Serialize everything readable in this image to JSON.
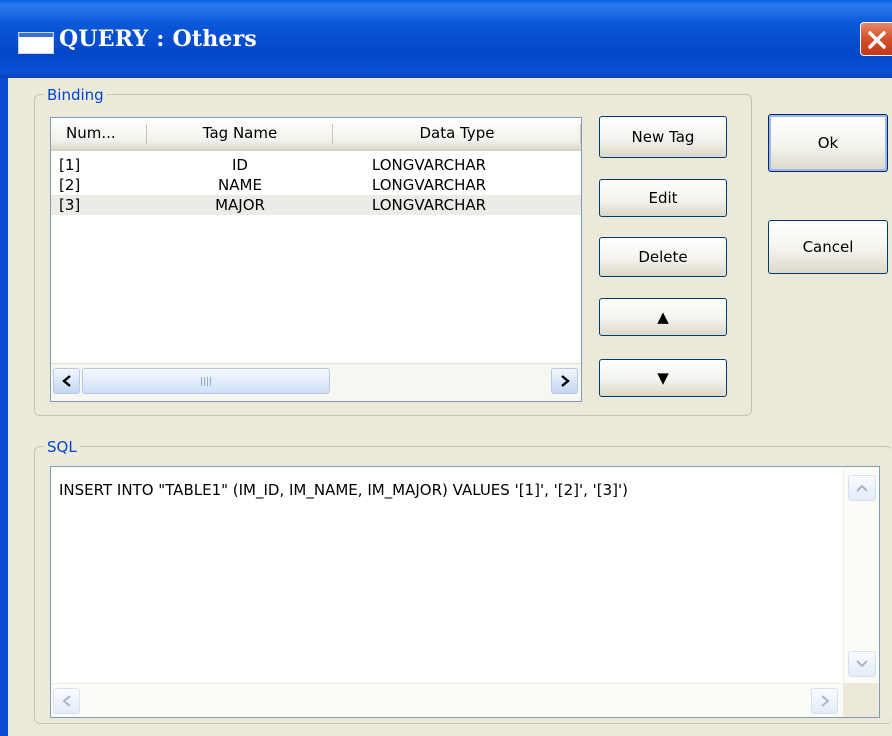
{
  "window": {
    "title": "QUERY : Others"
  },
  "binding": {
    "group_label": "Binding",
    "columns": [
      "Num...",
      "Tag Name",
      "Data Type"
    ],
    "rows": [
      {
        "num": "[1]",
        "tag_name": "ID",
        "data_type": "LONGVARCHAR"
      },
      {
        "num": "[2]",
        "tag_name": "NAME",
        "data_type": "LONGVARCHAR"
      },
      {
        "num": "[3]",
        "tag_name": "MAJOR",
        "data_type": "LONGVARCHAR"
      }
    ],
    "selected_row": 3,
    "buttons": {
      "new_tag": "New Tag",
      "edit": "Edit",
      "delete": "Delete",
      "move_up": "▲",
      "move_down": "▼"
    },
    "scroll_grip": "III"
  },
  "dialog_buttons": {
    "ok": "Ok",
    "cancel": "Cancel"
  },
  "sql": {
    "group_label": "SQL",
    "text": "INSERT INTO \"TABLE1\" (IM_ID, IM_NAME, IM_MAJOR) VALUES '[1]', '[2]', '[3]')"
  },
  "colors": {
    "title_bar": "#0A4AD0",
    "group_label": "#0046D5",
    "dialog_bg": "#ECE9D8",
    "close_button": "#D2502C"
  },
  "icons": {
    "window": "app-window-icon",
    "close": "close-x-icon",
    "scroll_left": "arrow-left-icon",
    "scroll_right": "arrow-right-icon",
    "scroll_up": "arrow-up-icon",
    "scroll_down": "arrow-down-icon"
  }
}
